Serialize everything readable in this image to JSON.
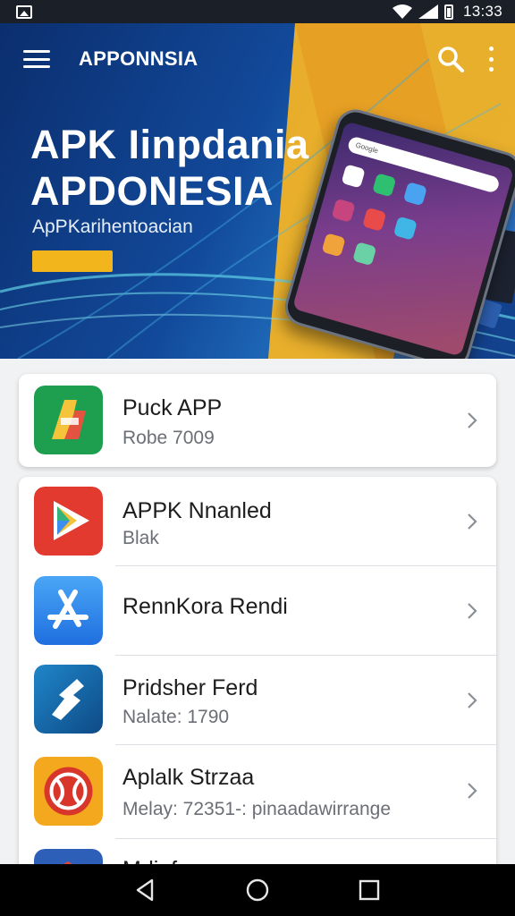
{
  "status_bar": {
    "time": "13:33",
    "icons": [
      "gallery-icon",
      "wifi-icon",
      "signal-icon",
      "battery-icon"
    ]
  },
  "toolbar": {
    "title": "APPONNSIA",
    "icons": [
      "menu-icon",
      "search-icon",
      "more-vertical-icon"
    ]
  },
  "hero": {
    "title_line1": "APK Iinpdania",
    "title_line2": "APDONESIA",
    "subtitle": "ApPKarihentoacian",
    "phone_search_text": "Google",
    "accent_color": "#f2b51c"
  },
  "featured_app": {
    "name": "Puck APP",
    "meta": "Robe 7009",
    "icon": "puck-app-icon"
  },
  "apps": [
    {
      "name": "APPK Nnanled",
      "meta": "Blak",
      "icon": "play-store-icon"
    },
    {
      "name": "RennKora Rendi",
      "meta": "",
      "icon": "app-store-icon"
    },
    {
      "name": "Pridsher Ferd",
      "meta": "Nalate: 1790",
      "icon": "pridsher-icon"
    },
    {
      "name": "Aplalk Strzaa",
      "meta": "Melay: 72351-: pinaadawirrange",
      "icon": "aplalk-icon"
    },
    {
      "name": "Mdinfe",
      "meta": "",
      "icon": "mdinfe-icon"
    }
  ],
  "nav_bar": {
    "icons": [
      "back-icon",
      "home-icon",
      "recents-icon"
    ]
  }
}
